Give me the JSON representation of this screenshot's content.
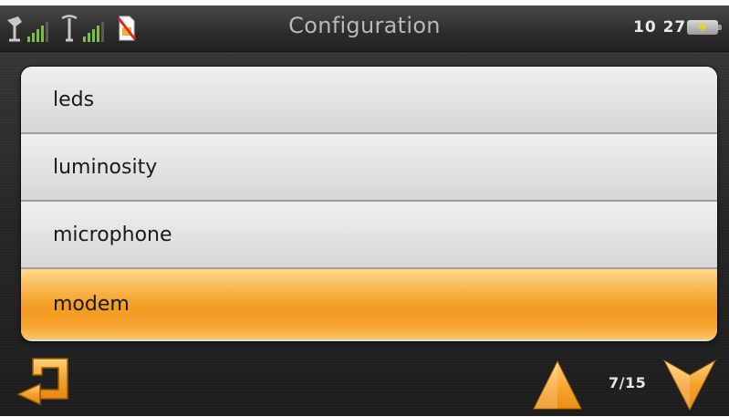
{
  "status_bar": {
    "title": "Configuration",
    "time_hour": "10",
    "time_minute": "27",
    "icons": [
      "satellite-antenna-icon",
      "signal-strength-icon",
      "gsm-antenna-icon",
      "signal-strength-icon",
      "no-sim-card-icon",
      "battery-charging-icon"
    ]
  },
  "list": {
    "items": [
      {
        "label": "leds",
        "selected": false
      },
      {
        "label": "luminosity",
        "selected": false
      },
      {
        "label": "microphone",
        "selected": false
      },
      {
        "label": "modem",
        "selected": true
      }
    ]
  },
  "navigation": {
    "page_indicator": "7/15",
    "icons": [
      "back-arrow-icon",
      "arrow-up-icon",
      "arrow-down-icon"
    ]
  },
  "colors": {
    "accent": "#f29b1f",
    "signal_green": "#7bc043",
    "title_text": "#b9b9b9"
  }
}
